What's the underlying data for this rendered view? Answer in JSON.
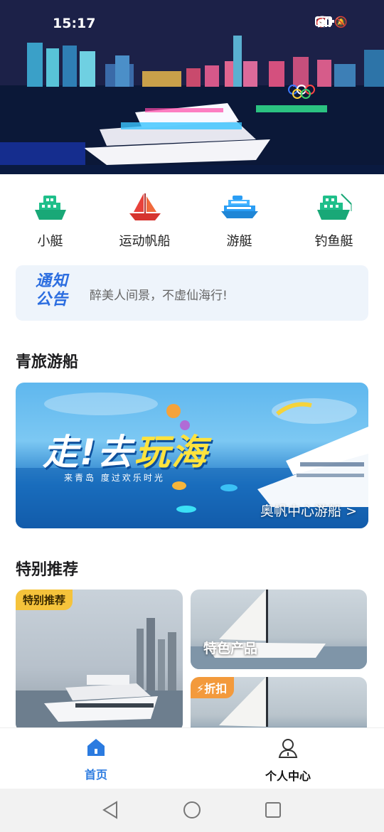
{
  "status_bar": {
    "time": "15:17",
    "icons": [
      "alarm-icon",
      "mute-icon",
      "wifi-icon",
      "4g-signal-icon",
      "battery-icon"
    ]
  },
  "categories": [
    {
      "label": "小艇",
      "icon": "small-boat-icon"
    },
    {
      "label": "运动帆船",
      "icon": "sailboat-icon"
    },
    {
      "label": "游艇",
      "icon": "yacht-icon"
    },
    {
      "label": "钓鱼艇",
      "icon": "fishing-boat-icon"
    }
  ],
  "notice": {
    "tag_line1": "通知",
    "tag_line2": "公告",
    "text": "醉美人间景，不虚仙海行!"
  },
  "section1": {
    "title": "青旅游船"
  },
  "banner": {
    "headline_a": "走!去",
    "headline_b": "玩",
    "headline_c": "海",
    "subtitle": "来青岛 度过欢乐时光",
    "caption": "奥帆中心游船 >"
  },
  "section2": {
    "title": "特别推荐"
  },
  "recommend": {
    "big_badge": "特别推荐",
    "small1_label": "特色产品",
    "small2_badge": "⚡折扣"
  },
  "tabs": [
    {
      "label": "首页",
      "icon": "home-icon",
      "active": true
    },
    {
      "label": "个人中心",
      "icon": "user-icon",
      "active": false
    }
  ],
  "colors": {
    "accent": "#2b7be0",
    "boat_green": "#1fbf8a",
    "sail_red": "#e8423b",
    "yacht_blue": "#2a9df4",
    "notice_bg": "#eef4fb",
    "badge_yellow": "#f5c33b",
    "badge_orange": "#f39a3c"
  }
}
